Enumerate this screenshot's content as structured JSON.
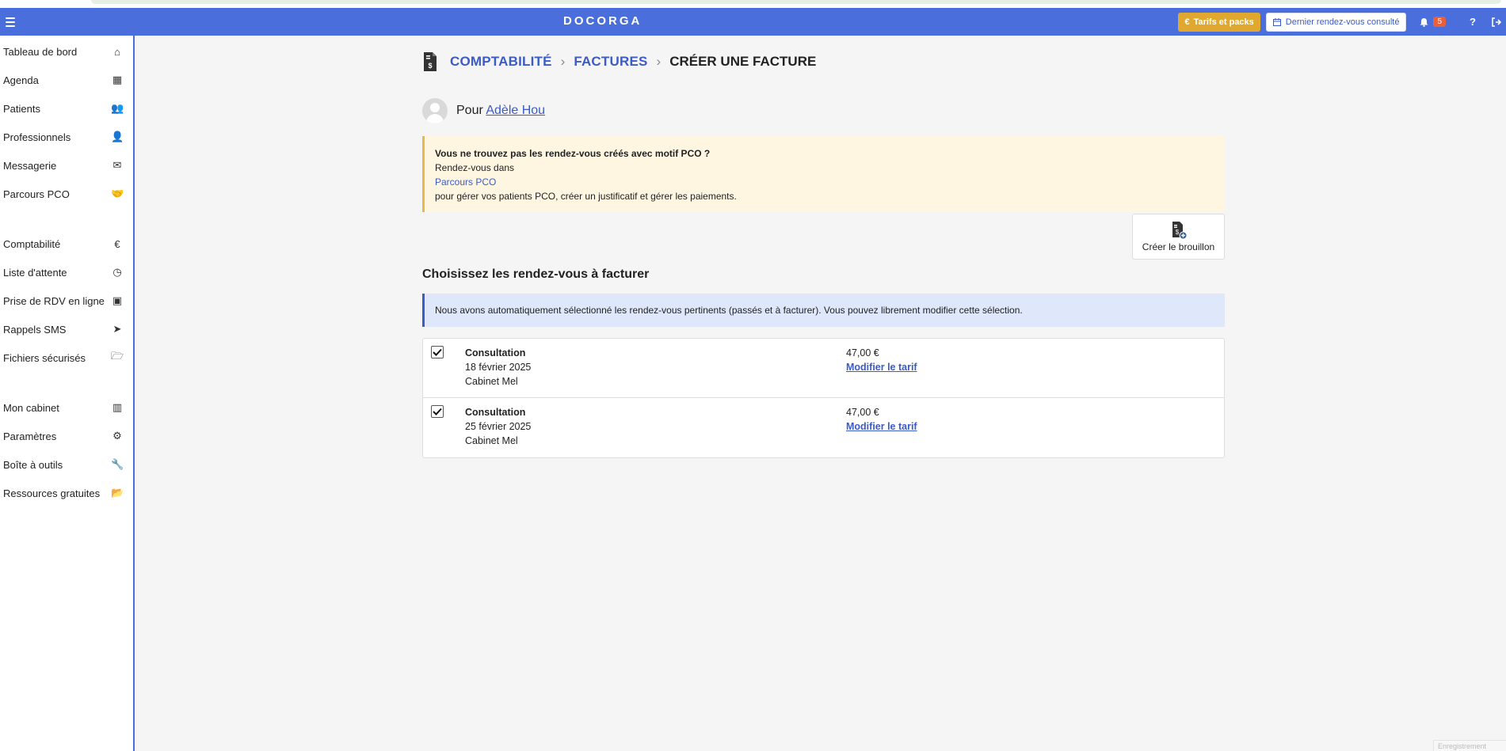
{
  "topbar": {
    "logo": "DOCORGA",
    "tarifs_label": "Tarifs et packs",
    "dernier_label": "Dernier rendez-vous consulté",
    "notif_count": "5"
  },
  "sidebar": {
    "group1": [
      {
        "label": "Tableau de bord",
        "icon": "home-icon",
        "glyph": "⌂"
      },
      {
        "label": "Agenda",
        "icon": "calendar-icon",
        "glyph": "▦"
      },
      {
        "label": "Patients",
        "icon": "users-icon",
        "glyph": "👥"
      },
      {
        "label": "Professionnels",
        "icon": "user-doctor-icon",
        "glyph": "👤"
      },
      {
        "label": "Messagerie",
        "icon": "envelope-icon",
        "glyph": "✉"
      },
      {
        "label": "Parcours PCO",
        "icon": "handshake-icon",
        "glyph": "🤝"
      }
    ],
    "group2": [
      {
        "label": "Comptabilité",
        "icon": "euro-icon",
        "glyph": "€"
      },
      {
        "label": "Liste d'attente",
        "icon": "clock-icon",
        "glyph": "◷"
      },
      {
        "label": "Prise de RDV en ligne",
        "icon": "calendar-plus-icon",
        "glyph": "▣"
      },
      {
        "label": "Rappels SMS",
        "icon": "paper-plane-icon",
        "glyph": "➤"
      },
      {
        "label": "Fichiers sécurisés",
        "icon": "folder-open-icon",
        "glyph": "🗁"
      }
    ],
    "group3": [
      {
        "label": "Mon cabinet",
        "icon": "building-icon",
        "glyph": "▥"
      },
      {
        "label": "Paramètres",
        "icon": "gear-icon",
        "glyph": "⚙"
      },
      {
        "label": "Boîte à outils",
        "icon": "wrench-icon",
        "glyph": "🔧"
      },
      {
        "label": "Ressources gratuites",
        "icon": "folder-icon",
        "glyph": "📂"
      }
    ]
  },
  "breadcrumb": {
    "level1": "COMPTABILITÉ",
    "level2": "FACTURES",
    "current": "CRÉER UNE FACTURE"
  },
  "patient": {
    "prefix": "Pour",
    "name": "Adèle Hou"
  },
  "warning": {
    "title": "Vous ne trouvez pas les rendez-vous créés avec motif PCO ?",
    "line2": "Rendez-vous dans",
    "link": "Parcours PCO",
    "line4": "pour gérer vos patients PCO, créer un justificatif et gérer les paiements."
  },
  "create_draft_label": "Créer le brouillon",
  "section_title": "Choisissez les rendez-vous à facturer",
  "info_text": "Nous avons automatiquement sélectionné les rendez-vous pertinents (passés et à facturer). Vous pouvez librement modifier cette sélection.",
  "appointments": [
    {
      "type": "Consultation",
      "date": "18 février 2025",
      "place": "Cabinet Mel",
      "price": "47,00 €",
      "modify": "Modifier le tarif",
      "checked": true
    },
    {
      "type": "Consultation",
      "date": "25 février 2025",
      "place": "Cabinet Mel",
      "price": "47,00 €",
      "modify": "Modifier le tarif",
      "checked": true
    }
  ],
  "corner_tag": "Enregistrement"
}
